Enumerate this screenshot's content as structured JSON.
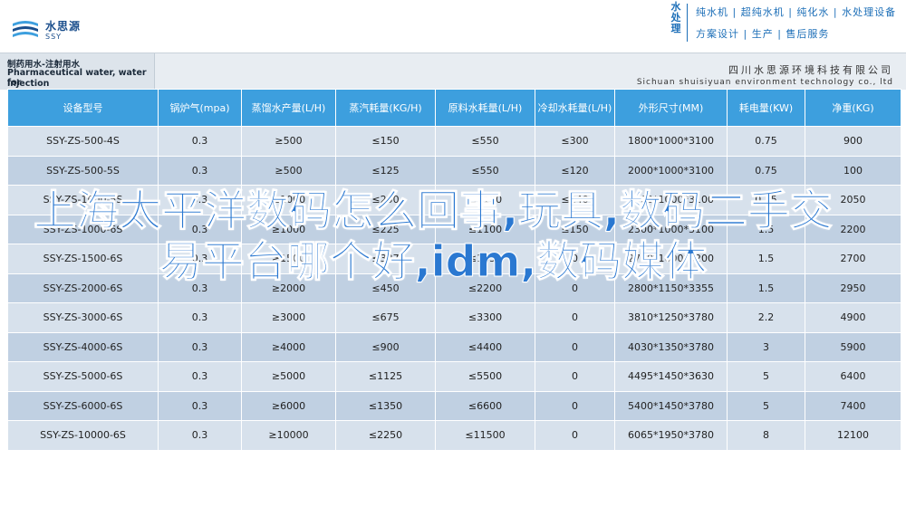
{
  "header": {
    "logo_cn": "水思源",
    "logo_en": "SSY",
    "brand_vertical": "水处理",
    "slogan1": "纯水机 | 超纯水机 | 纯化水 | 水处理设备",
    "slogan2": "方案设计 | 生产 | 售后服务"
  },
  "titlebar": {
    "left_line1": "制药用水-注射用水",
    "left_line2": "Pharmaceutical water, water for",
    "left_line3": "injection",
    "company_cn": "四川水思源环境科技有限公司",
    "company_en": "Sichuan shuisiyuan environment technology co., ltd"
  },
  "table": {
    "headers": [
      "设备型号",
      "锅炉气(mpa)",
      "蒸馏水产量(L/H)",
      "蒸汽耗量(KG/H)",
      "原料水耗量(L/H)",
      "冷却水耗量(L/H)",
      "外形尺寸(MM)",
      "耗电量(KW)",
      "净重(KG)"
    ],
    "rows": [
      [
        "SSY-ZS-500-4S",
        "0.3",
        "≥500",
        "≤150",
        "≤550",
        "≤300",
        "1800*1000*3100",
        "0.75",
        "900"
      ],
      [
        "SSY-ZS-500-5S",
        "0.3",
        "≥500",
        "≤125",
        "≤550",
        "≤120",
        "2000*1000*3100",
        "0.75",
        "100"
      ],
      [
        "SSY-ZS-1000-5S",
        "0.3",
        "≥1000",
        "≤250",
        "≤1100",
        "≤240",
        "2100*1000*3100",
        "0.75",
        "2050"
      ],
      [
        "SSY-ZS-1000-6S",
        "0.3",
        "≥1000",
        "≤225",
        "≤1100",
        "≤150",
        "2300*1000*3100",
        "1.5",
        "2200"
      ],
      [
        "SSY-ZS-1500-6S",
        "0.3",
        "≥1500",
        "≤337",
        "≤1650",
        "0",
        "2750*1000*3200",
        "1.5",
        "2700"
      ],
      [
        "SSY-ZS-2000-6S",
        "0.3",
        "≥2000",
        "≤450",
        "≤2200",
        "0",
        "2800*1150*3355",
        "1.5",
        "2950"
      ],
      [
        "SSY-ZS-3000-6S",
        "0.3",
        "≥3000",
        "≤675",
        "≤3300",
        "0",
        "3810*1250*3780",
        "2.2",
        "4900"
      ],
      [
        "SSY-ZS-4000-6S",
        "0.3",
        "≥4000",
        "≤900",
        "≤4400",
        "0",
        "4030*1350*3780",
        "3",
        "5900"
      ],
      [
        "SSY-ZS-5000-6S",
        "0.3",
        "≥5000",
        "≤1125",
        "≤5500",
        "0",
        "4495*1450*3630",
        "5",
        "6400"
      ],
      [
        "SSY-ZS-6000-6S",
        "0.3",
        "≥6000",
        "≤1350",
        "≤6600",
        "0",
        "5400*1450*3780",
        "5",
        "7400"
      ],
      [
        "SSY-ZS-10000-6S",
        "0.3",
        "≥10000",
        "≤2250",
        "≤11500",
        "0",
        "6065*1950*3780",
        "8",
        "12100"
      ]
    ]
  },
  "overlay_title": "上海太平洋数码怎么回事,玩具,数码二手交易平台哪个好,idm,数码媒体"
}
